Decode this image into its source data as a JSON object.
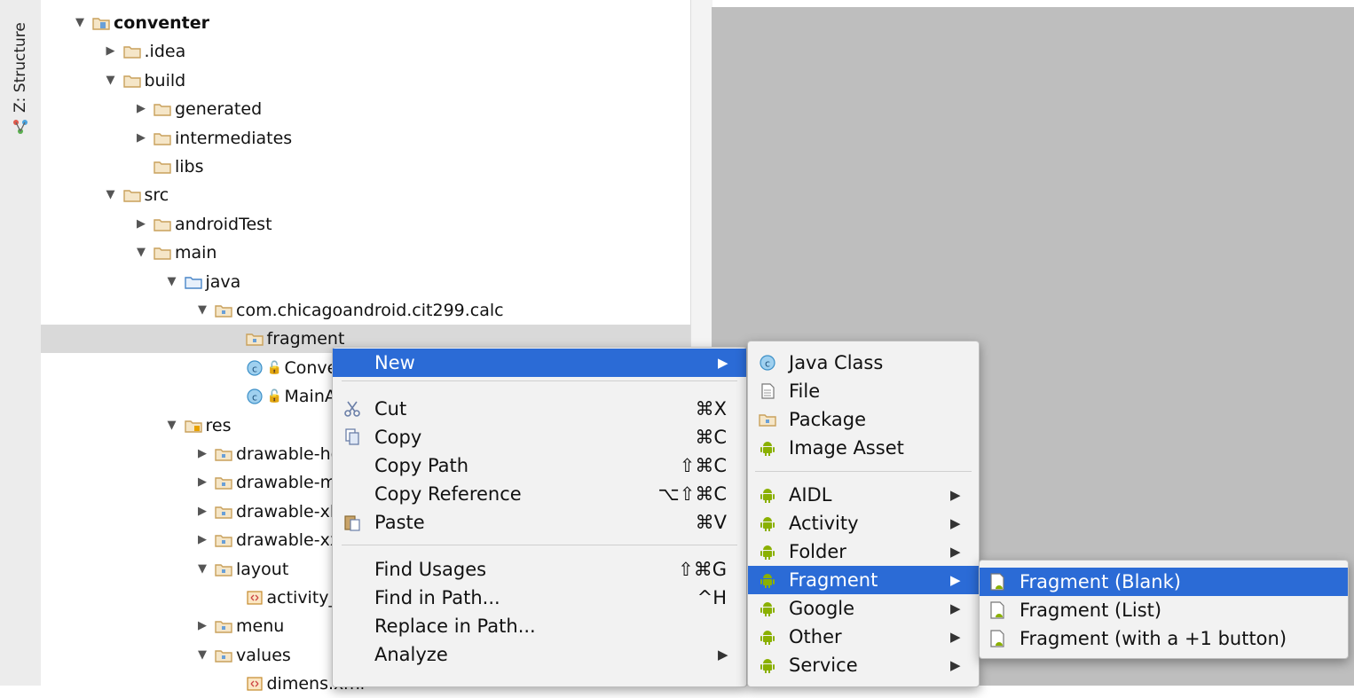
{
  "structure_tab": {
    "label": "Z: Structure",
    "icon": "structure-icon"
  },
  "tree": [
    {
      "label": "conventer",
      "expanded": true,
      "bold": true,
      "icon": "module-folder-icon"
    },
    {
      "label": ".idea",
      "expanded": false,
      "icon": "folder-icon"
    },
    {
      "label": "build",
      "expanded": true,
      "icon": "folder-icon"
    },
    {
      "label": "generated",
      "expanded": false,
      "icon": "folder-icon"
    },
    {
      "label": "intermediates",
      "expanded": false,
      "icon": "folder-icon"
    },
    {
      "label": "libs",
      "icon": "folder-icon"
    },
    {
      "label": "src",
      "expanded": true,
      "icon": "folder-icon"
    },
    {
      "label": "androidTest",
      "expanded": false,
      "icon": "folder-icon"
    },
    {
      "label": "main",
      "expanded": true,
      "icon": "folder-icon"
    },
    {
      "label": "java",
      "expanded": true,
      "icon": "source-folder-icon"
    },
    {
      "label": "com.chicagoandroid.cit299.calc",
      "expanded": true,
      "icon": "package-icon"
    },
    {
      "label": "fragment",
      "selected": true,
      "icon": "package-icon"
    },
    {
      "label": "ConversionConstants",
      "icon": "class-icon"
    },
    {
      "label": "MainActivity",
      "icon": "class-icon"
    },
    {
      "label": "res",
      "expanded": true,
      "icon": "resource-folder-icon"
    },
    {
      "label": "drawable-hdpi",
      "expanded": false,
      "icon": "package-icon"
    },
    {
      "label": "drawable-mdpi",
      "expanded": false,
      "icon": "package-icon"
    },
    {
      "label": "drawable-xhdpi",
      "expanded": false,
      "icon": "package-icon"
    },
    {
      "label": "drawable-xxhdpi",
      "expanded": false,
      "icon": "package-icon"
    },
    {
      "label": "layout",
      "expanded": true,
      "icon": "package-icon"
    },
    {
      "label": "activity_main.xml",
      "icon": "xml-file-icon"
    },
    {
      "label": "menu",
      "expanded": false,
      "icon": "package-icon"
    },
    {
      "label": "values",
      "expanded": true,
      "icon": "package-icon"
    },
    {
      "label": "dimens.xml",
      "icon": "xml-file-icon"
    }
  ],
  "context_menu": [
    {
      "label": "New",
      "has_submenu": true,
      "highlighted": true
    },
    {
      "label": "Cut",
      "shortcut": "⌘X",
      "icon": "scissors-icon"
    },
    {
      "label": "Copy",
      "shortcut": "⌘C",
      "icon": "copy-icon"
    },
    {
      "label": "Copy Path",
      "shortcut": "⇧⌘C"
    },
    {
      "label": "Copy Reference",
      "shortcut": "⌥⇧⌘C"
    },
    {
      "label": "Paste",
      "shortcut": "⌘V",
      "icon": "paste-icon"
    },
    {
      "label": "Find Usages",
      "shortcut": "⇧⌘G"
    },
    {
      "label": "Find in Path...",
      "shortcut": "^H"
    },
    {
      "label": "Replace in Path..."
    },
    {
      "label": "Analyze",
      "has_submenu": true
    }
  ],
  "new_submenu": [
    {
      "label": "Java Class",
      "icon": "java-class-icon"
    },
    {
      "label": "File",
      "icon": "file-icon"
    },
    {
      "label": "Package",
      "icon": "package-icon"
    },
    {
      "label": "Image Asset",
      "icon": "android-icon"
    },
    {
      "label": "AIDL",
      "icon": "android-icon",
      "has_submenu": true
    },
    {
      "label": "Activity",
      "icon": "android-icon",
      "has_submenu": true
    },
    {
      "label": "Folder",
      "icon": "android-icon",
      "has_submenu": true
    },
    {
      "label": "Fragment",
      "icon": "android-icon",
      "has_submenu": true,
      "highlighted": true
    },
    {
      "label": "Google",
      "icon": "android-icon",
      "has_submenu": true
    },
    {
      "label": "Other",
      "icon": "android-icon",
      "has_submenu": true
    },
    {
      "label": "Service",
      "icon": "android-icon",
      "has_submenu": true
    }
  ],
  "fragment_submenu": [
    {
      "label": "Fragment (Blank)",
      "icon": "fragment-template-icon",
      "highlighted": true
    },
    {
      "label": "Fragment (List)",
      "icon": "fragment-template-icon"
    },
    {
      "label": "Fragment (with a +1 button)",
      "icon": "fragment-template-icon"
    }
  ],
  "colors": {
    "highlight": "#2b6bd6",
    "folder": "#c9a15c",
    "android_green": "#8ab000",
    "editor_bg": "#bebebe"
  }
}
